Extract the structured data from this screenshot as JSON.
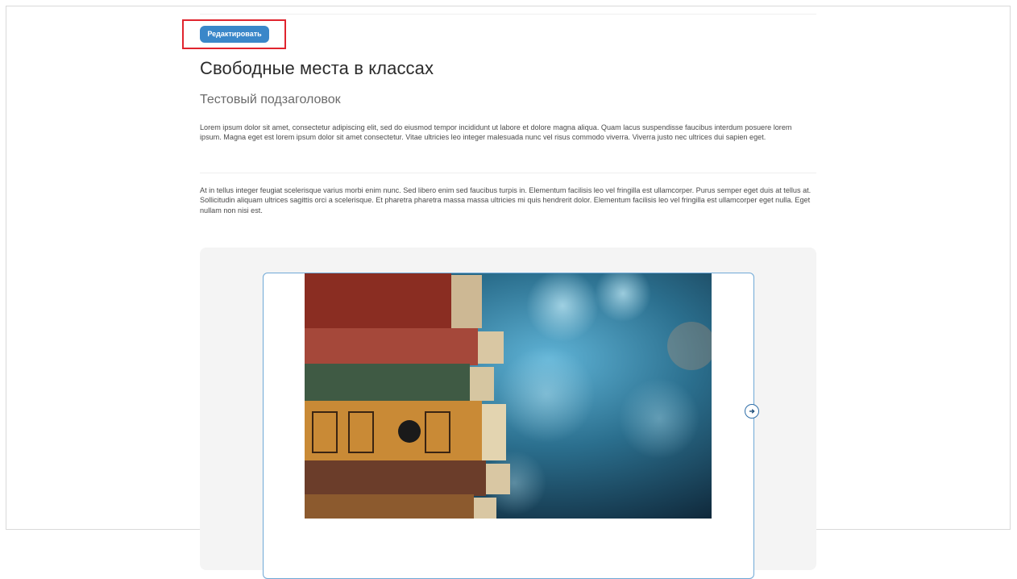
{
  "toolbar": {
    "edit_label": "Редактировать"
  },
  "page": {
    "title": "Свободные места в классах",
    "subtitle": "Тестовый подзаголовок",
    "paragraph1": "Lorem ipsum dolor sit amet, consectetur adipiscing elit, sed do eiusmod tempor incididunt ut labore et dolore magna aliqua. Quam lacus suspendisse faucibus interdum posuere lorem ipsum. Magna eget est lorem ipsum dolor sit amet consectetur. Vitae ultricies leo integer malesuada nunc vel risus commodo viverra. Viverra justo nec ultrices dui sapien eget.",
    "paragraph2": "At in tellus integer feugiat scelerisque varius morbi enim nunc. Sed libero enim sed faucibus turpis in. Elementum facilisis leo vel fringilla est ullamcorper. Purus semper eget duis at tellus at. Sollicitudin aliquam ultrices sagittis orci a scelerisque. Et pharetra pharetra massa massa ultricies mi quis hendrerit dolor. Elementum facilisis leo vel fringilla est ullamcorper eget nulla. Eget nullam non nisi est."
  },
  "gallery": {
    "image_subject": "stack of old books",
    "next_icon": "arrow-right-icon"
  },
  "colors": {
    "accent": "#3a87c9",
    "highlight": "#e0242e",
    "panel_bg": "#f4f4f4"
  }
}
